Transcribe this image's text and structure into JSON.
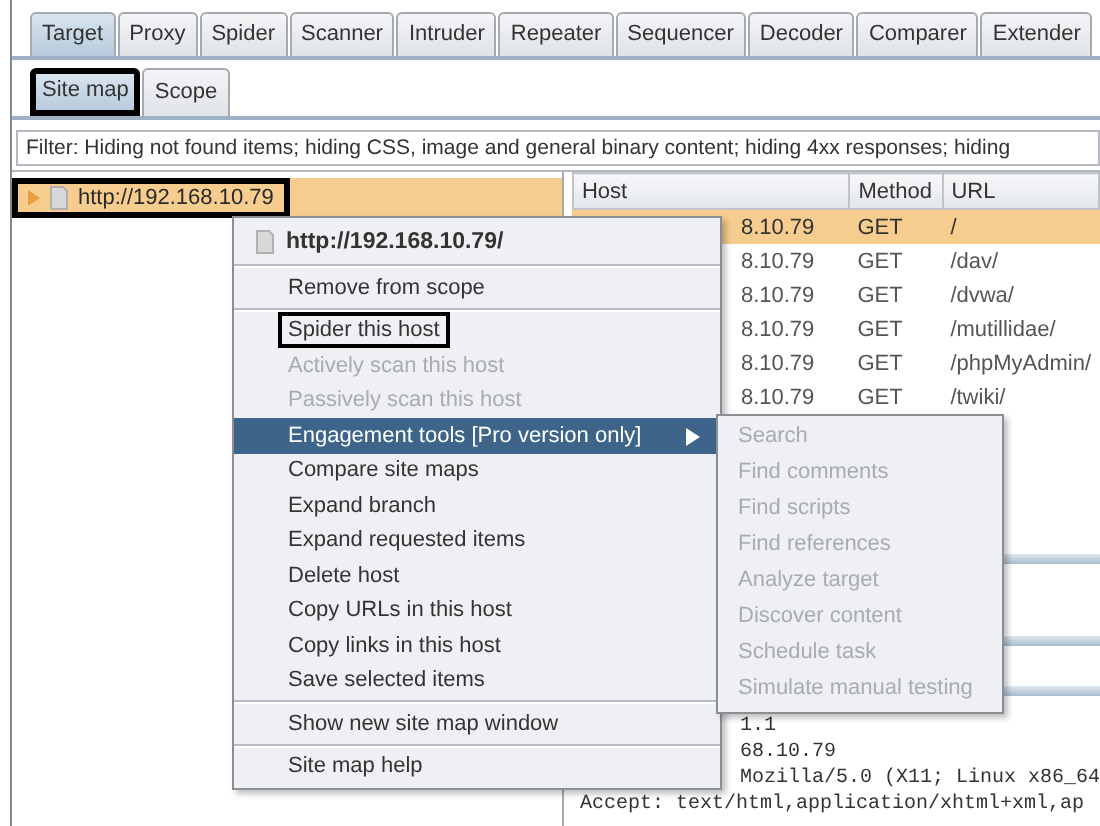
{
  "tabs": [
    {
      "label": "Target",
      "selected": true
    },
    {
      "label": "Proxy",
      "selected": false
    },
    {
      "label": "Spider",
      "selected": false
    },
    {
      "label": "Scanner",
      "selected": false
    },
    {
      "label": "Intruder",
      "selected": false
    },
    {
      "label": "Repeater",
      "selected": false
    },
    {
      "label": "Sequencer",
      "selected": false
    },
    {
      "label": "Decoder",
      "selected": false
    },
    {
      "label": "Comparer",
      "selected": false
    },
    {
      "label": "Extender",
      "selected": false
    }
  ],
  "site_map_tabs": [
    {
      "label": "Site map",
      "selected": true,
      "outlined": true
    },
    {
      "label": "Scope",
      "selected": false,
      "outlined": false
    }
  ],
  "filter": "Filter: Hiding not found items;  hiding CSS, image and general binary content;  hiding 4xx responses;  hiding",
  "tree": [
    {
      "label": "http://192.168.10.79",
      "selected": true,
      "expanded": false,
      "outlined": true
    }
  ],
  "table": {
    "columns": [
      "Host",
      "Method",
      "URL"
    ],
    "rows": [
      {
        "host": "8.10.79",
        "method": "GET",
        "url": "/",
        "selected": true
      },
      {
        "host": "8.10.79",
        "method": "GET",
        "url": "/dav/",
        "selected": false
      },
      {
        "host": "8.10.79",
        "method": "GET",
        "url": "/dvwa/",
        "selected": false
      },
      {
        "host": "8.10.79",
        "method": "GET",
        "url": "/mutillidae/",
        "selected": false
      },
      {
        "host": "8.10.79",
        "method": "GET",
        "url": "/phpMyAdmin/",
        "selected": false
      },
      {
        "host": "8.10.79",
        "method": "GET",
        "url": "/twiki/",
        "selected": false
      }
    ]
  },
  "request": [
    {
      "text": "1.1",
      "kind": "covered"
    },
    {
      "text": "68.10.79",
      "kind": "covered"
    },
    {
      "text": "Mozilla/5.0 (X11; Linux x86_64",
      "kind": "covered"
    },
    {
      "text": "Accept: text/html,application/xhtml+xml,ap",
      "kind": "full"
    }
  ],
  "context_menu": {
    "header": "http://192.168.10.79/",
    "items": [
      {
        "kind": "separator"
      },
      {
        "kind": "item",
        "label": "Remove from scope",
        "disabled": false,
        "selected": false,
        "outlined": false
      },
      {
        "kind": "separator"
      },
      {
        "kind": "item",
        "label": "Spider this host",
        "disabled": false,
        "selected": false,
        "outlined": true
      },
      {
        "kind": "item",
        "label": "Actively scan this host",
        "disabled": true,
        "selected": false,
        "outlined": false
      },
      {
        "kind": "item",
        "label": "Passively scan this host",
        "disabled": true,
        "selected": false,
        "outlined": false
      },
      {
        "kind": "submenu",
        "label": "Engagement tools [Pro version only]",
        "disabled": false,
        "selected": true,
        "outlined": false
      },
      {
        "kind": "item",
        "label": "Compare site maps",
        "disabled": false,
        "selected": false,
        "outlined": false
      },
      {
        "kind": "item",
        "label": "Expand branch",
        "disabled": false,
        "selected": false,
        "outlined": false
      },
      {
        "kind": "item",
        "label": "Expand requested items",
        "disabled": false,
        "selected": false,
        "outlined": false
      },
      {
        "kind": "item",
        "label": "Delete host",
        "disabled": false,
        "selected": false,
        "outlined": false
      },
      {
        "kind": "item",
        "label": "Copy URLs in this host",
        "disabled": false,
        "selected": false,
        "outlined": false
      },
      {
        "kind": "item",
        "label": "Copy links in this host",
        "disabled": false,
        "selected": false,
        "outlined": false
      },
      {
        "kind": "item",
        "label": "Save selected items",
        "disabled": false,
        "selected": false,
        "outlined": false
      },
      {
        "kind": "separator"
      },
      {
        "kind": "item",
        "label": "Show new site map window",
        "disabled": false,
        "selected": false,
        "outlined": false
      },
      {
        "kind": "separator"
      },
      {
        "kind": "item",
        "label": "Site map help",
        "disabled": false,
        "selected": false,
        "outlined": false
      }
    ]
  },
  "submenu": [
    {
      "label": "Search",
      "disabled": true
    },
    {
      "label": "Find comments",
      "disabled": true
    },
    {
      "label": "Find scripts",
      "disabled": true
    },
    {
      "label": "Find references",
      "disabled": true
    },
    {
      "label": "Analyze target",
      "disabled": true
    },
    {
      "label": "Discover content",
      "disabled": true
    },
    {
      "label": "Schedule task",
      "disabled": true
    },
    {
      "label": "Simulate manual testing",
      "disabled": true
    }
  ]
}
